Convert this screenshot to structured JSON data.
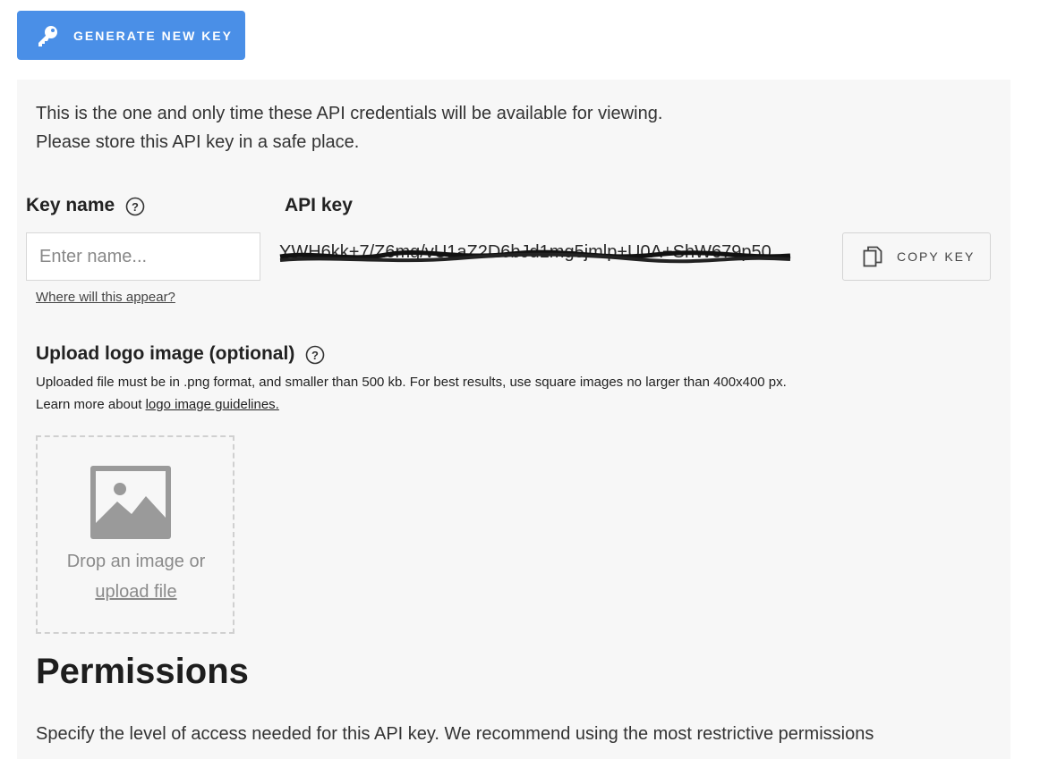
{
  "generate_button": {
    "label": "GENERATE NEW KEY",
    "icon": "key-icon"
  },
  "notice": {
    "line1": "This is the one and only time these API credentials will be available for viewing.",
    "line2": "Please store this API key in a safe place."
  },
  "key_name": {
    "label": "Key name",
    "placeholder": "Enter name...",
    "help_link": "Where will this appear?"
  },
  "api_key": {
    "label": "API key",
    "value": "YWH6kk+7/Z6mg/vU1aZ2D6bJd1mg5jmlp+U0A+ShW679p50",
    "copy_label": "COPY KEY"
  },
  "upload": {
    "title": "Upload logo image (optional)",
    "desc_line1": "Uploaded file must be in .png format, and smaller than 500 kb. For best results, use square images no larger than 400x400 px.",
    "desc_line2_prefix": "Learn more about ",
    "desc_line2_link": "logo image guidelines.",
    "drop_text": "Drop an image or",
    "upload_link": "upload file"
  },
  "permissions": {
    "title": "Permissions",
    "desc": "Specify the level of access needed for this API key. We recommend using the most restrictive permissions"
  },
  "colors": {
    "accent": "#4a8fe7",
    "panel_bg": "#f7f7f7"
  }
}
